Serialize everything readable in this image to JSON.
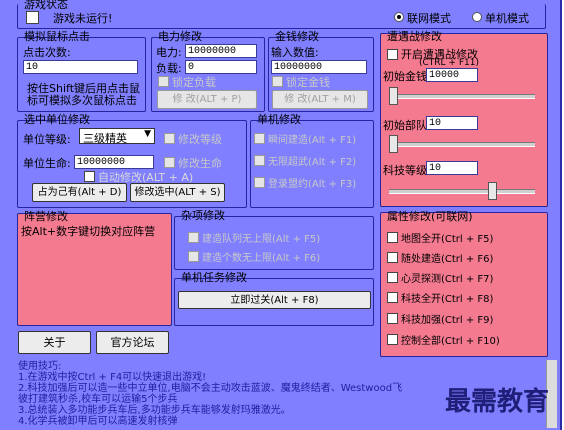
{
  "status": {
    "title": "游戏状态",
    "not_running": "游戏未运行!",
    "mode_network": "联网模式",
    "mode_single": "单机模式",
    "selected_mode": "联网模式"
  },
  "mouse": {
    "title": "模拟鼠标点击",
    "count_label": "点击次数:",
    "count_value": "10",
    "hint_line1": "按住Shift键后用点击鼠",
    "hint_line2": "标可模拟多次鼠标点击"
  },
  "power": {
    "title": "电力修改",
    "power_label": "电力:",
    "power_value": "10000000",
    "load_label": "负载:",
    "load_value": "0",
    "lock_label": "锁定负载",
    "button": "修 改(ALT + P)"
  },
  "money": {
    "title": "金钱修改",
    "input_label": "输入数值:",
    "input_value": "10000000",
    "lock_label": "锁定金钱",
    "button": "修 改(ALT + M)"
  },
  "encounter": {
    "title": "遭遇战修改",
    "enable_label": "开启遭遇战修改",
    "enable_hotkey": "(CTRL + F11)",
    "money_label": "初始金钱",
    "money_value": "10000",
    "units_label": "初始部队",
    "units_value": "10",
    "tech_label": "科技等级",
    "tech_value": "10"
  },
  "unit": {
    "title": "选中单位修改",
    "level_label": "单位等级:",
    "level_value": "三级精英",
    "hp_label": "单位生命:",
    "hp_value": "10000000",
    "modify_level": "修改等级",
    "modify_hp": "修改生命",
    "auto_modify": "自动修改(ALT + A)",
    "btn_own": "占为己有(Alt + D)",
    "btn_modify": "修改选中(ALT + S)"
  },
  "single": {
    "title": "单机修改",
    "opt1": "瞬间建造(Alt + F1)",
    "opt2": "无限超武(Alt + F2)",
    "opt3": "登录盟约(Alt + F3)"
  },
  "faction": {
    "title": "阵营修改",
    "hint": "按Alt+数字键切换对应阵营"
  },
  "misc": {
    "title": "杂项修改",
    "opt1": "建造队列无上限(Alt + F5)",
    "opt2": "建造个数无上限(Alt + F6)"
  },
  "mission": {
    "title": "单机任务修改",
    "button": "立即过关(Alt + F8)"
  },
  "attr": {
    "title": "属性修改(可联网)",
    "items": [
      "地图全开(Ctrl + F5)",
      "随处建造(Ctrl + F6)",
      "心灵探测(Ctrl + F7)",
      "科技全开(Ctrl + F8)",
      "科技加强(Ctrl + F9)",
      "控制全部(Ctrl + F10)"
    ]
  },
  "footer": {
    "about": "关于",
    "forum": "官方论坛"
  },
  "tips": {
    "title": "使用技巧:",
    "lines": [
      "1.在游戏中按Ctrl + F4可以快速退出游戏!",
      "2.科技加强后可以造一些中立单位,电脑不会主动攻击蓝波、魔鬼终结者、Westwood飞",
      "彼打建筑秒杀,校车可以运输5个步兵",
      "3.总统装入多功能步兵车后,多功能步兵车能够发射玛雅激光。",
      "4.化学兵被卸甲后可以高速发射核弹"
    ]
  },
  "watermark": "最需教育"
}
